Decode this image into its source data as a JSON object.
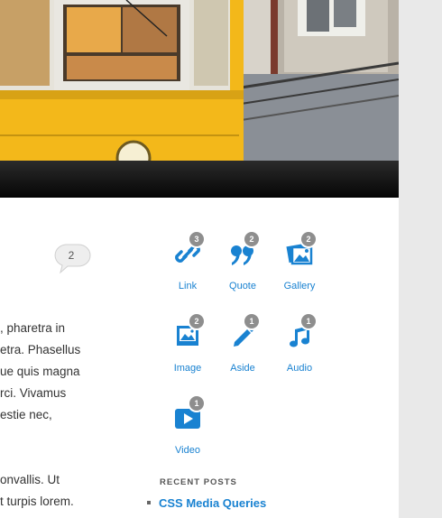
{
  "comment_count": "2",
  "post_text": [
    ", pharetra in",
    "etra. Phasellus",
    "ue quis magna",
    "rci. Vivamus",
    "estie nec,"
  ],
  "post_text_2": [
    "onvallis. Ut",
    "t turpis lorem."
  ],
  "post_formats": [
    {
      "label": "Link",
      "count": "3",
      "icon": "link-icon"
    },
    {
      "label": "Quote",
      "count": "2",
      "icon": "quote-icon"
    },
    {
      "label": "Gallery",
      "count": "2",
      "icon": "gallery-icon"
    },
    {
      "label": "Image",
      "count": "2",
      "icon": "image-icon"
    },
    {
      "label": "Aside",
      "count": "1",
      "icon": "pencil-icon"
    },
    {
      "label": "Audio",
      "count": "1",
      "icon": "music-note-icon"
    },
    {
      "label": "Video",
      "count": "1",
      "icon": "video-icon"
    }
  ],
  "recent_posts": {
    "heading": "RECENT POSTS",
    "items": [
      "CSS Media Queries"
    ]
  },
  "colors": {
    "link": "#1982d1",
    "badge": "#8e8e8e",
    "tram": "#f3b81a"
  }
}
